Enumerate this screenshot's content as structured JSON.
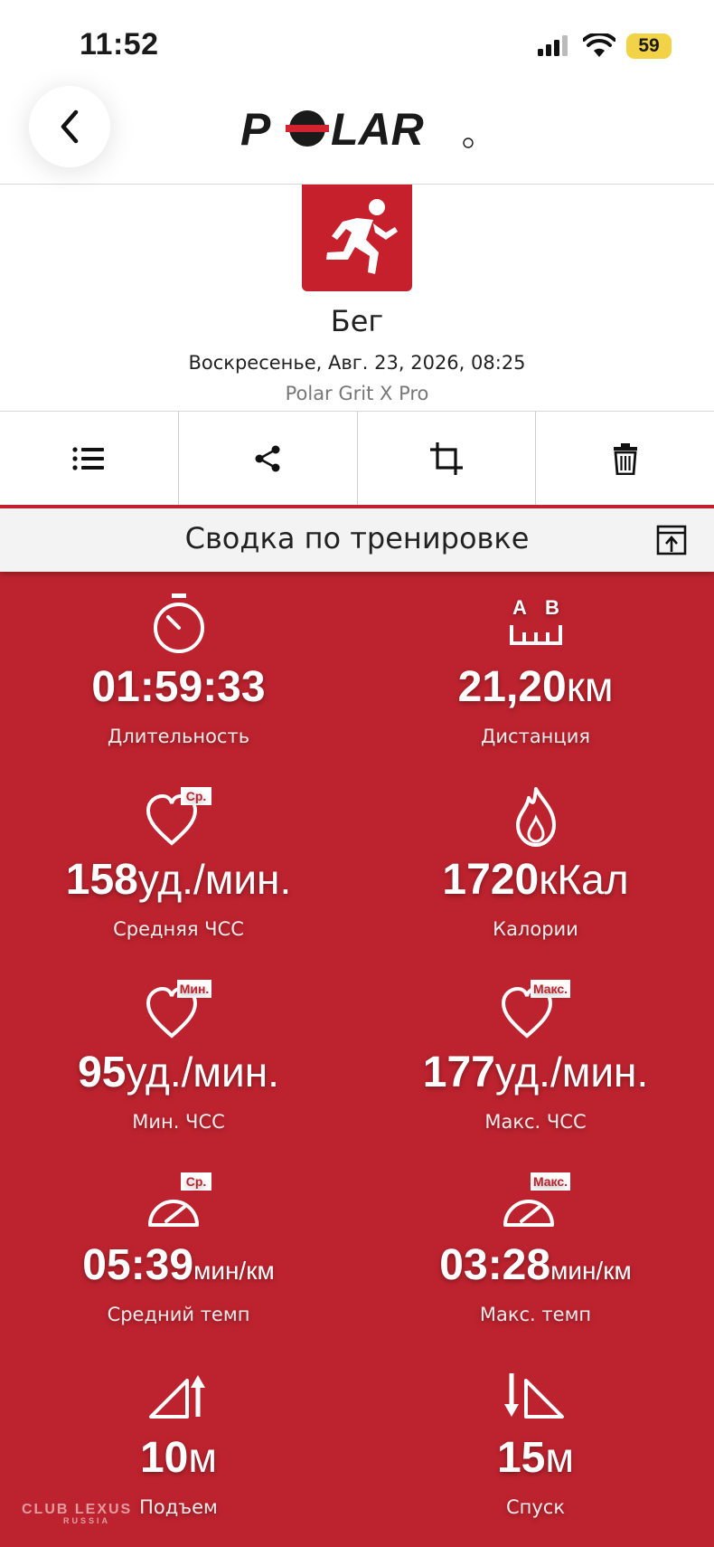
{
  "status_bar": {
    "time": "11:52",
    "battery": "59"
  },
  "header": {
    "logo_text": "POLAR"
  },
  "activity": {
    "sport": "Бег",
    "date": "Воскресенье, Авг. 23, 2026, 08:25",
    "device": "Polar Grit X Pro"
  },
  "toolbar": {
    "icons": [
      "list-icon",
      "share-icon",
      "crop-icon",
      "trash-icon"
    ]
  },
  "summary": {
    "title": "Сводка по тренировке"
  },
  "stats": {
    "duration": {
      "value": "01:59:33",
      "unit": "",
      "label": "Длительность"
    },
    "distance": {
      "value": "21,20",
      "unit": "км",
      "label": "Дистанция",
      "icon_a": "A",
      "icon_b": "B"
    },
    "avg_hr": {
      "value": "158",
      "unit": "уд./мин.",
      "label": "Средняя ЧСС",
      "badge": "Ср."
    },
    "calories": {
      "value": "1720",
      "unit": "кКал",
      "label": "Калории"
    },
    "min_hr": {
      "value": "95",
      "unit": "уд./мин.",
      "label": "Мин. ЧСС",
      "badge": "Мин."
    },
    "max_hr": {
      "value": "177",
      "unit": "уд./мин.",
      "label": "Макс. ЧСС",
      "badge": "Макс."
    },
    "avg_pace": {
      "value": "05:39",
      "unit": "мин/км",
      "label": "Средний темп",
      "badge": "Ср."
    },
    "max_pace": {
      "value": "03:28",
      "unit": "мин/км",
      "label": "Макс. темп",
      "badge": "Макс."
    },
    "ascent": {
      "value": "10",
      "unit": "м",
      "label": "Подъем"
    },
    "descent": {
      "value": "15",
      "unit": "м",
      "label": "Спуск"
    }
  },
  "watermark": {
    "line1": "CLUB LEXUS",
    "line2": "RUSSIA"
  },
  "colors": {
    "brand_red": "#bd232e",
    "icon_red": "#c5202b"
  }
}
